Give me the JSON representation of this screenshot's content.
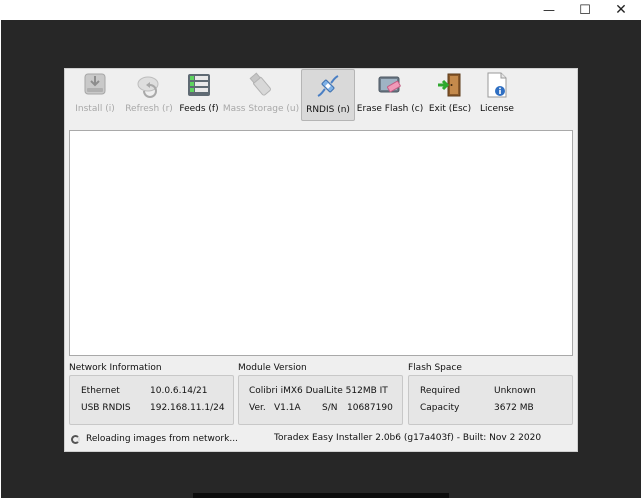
{
  "window": {
    "minimize_glyph": "—",
    "maximize_glyph": "☐",
    "close_glyph": "✕"
  },
  "toolbar": {
    "items": [
      {
        "label": "Install (i)",
        "icon": "install-icon",
        "enabled": false
      },
      {
        "label": "Refresh (r)",
        "icon": "refresh-icon",
        "enabled": false
      },
      {
        "label": "Feeds (f)",
        "icon": "feeds-icon",
        "enabled": true
      },
      {
        "label": "Mass Storage (u)",
        "icon": "usb-stick-icon",
        "enabled": false
      },
      {
        "label": "RNDIS (n)",
        "icon": "rndis-cable-icon",
        "enabled": true,
        "active": true
      },
      {
        "label": "Erase Flash (c)",
        "icon": "erase-flash-icon",
        "enabled": true
      },
      {
        "label": "Exit (Esc)",
        "icon": "exit-door-icon",
        "enabled": true
      },
      {
        "label": "License",
        "icon": "license-document-icon",
        "enabled": true
      }
    ]
  },
  "network": {
    "title": "Network Information",
    "ethernet_label": "Ethernet",
    "ethernet_value": "10.0.6.14/21",
    "usb_label": "USB RNDIS",
    "usb_value": "192.168.11.1/24"
  },
  "module": {
    "title": "Module Version",
    "name": "Colibri iMX6 DualLite 512MB IT",
    "ver_label": "Ver.",
    "ver_value": "V1.1A",
    "sn_label": "S/N",
    "sn_value": "10687190"
  },
  "flash": {
    "title": "Flash Space",
    "required_label": "Required",
    "required_value": "Unknown",
    "capacity_label": "Capacity",
    "capacity_value": "3672 MB"
  },
  "status": {
    "message": "Reloading images from network...",
    "version": "Toradex Easy Installer 2.0b6 (g17a403f) - Built: Nov  2 2020"
  },
  "colors": {
    "desktop": "#272727",
    "app_bg": "#efefef",
    "list_bg": "#ffffff",
    "info_bg": "#e6e6e6",
    "disabled_text": "#a8a8a8"
  }
}
